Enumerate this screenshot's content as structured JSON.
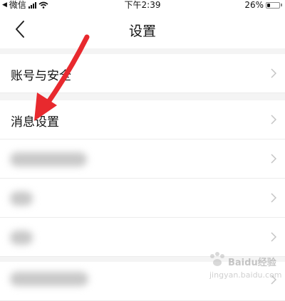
{
  "status_bar": {
    "carrier": "微信",
    "time": "下午2:39",
    "battery_percent": "26%",
    "battery_level": 0.26
  },
  "nav": {
    "title": "设置",
    "back_icon": "chevron-left-icon"
  },
  "sections": [
    {
      "items": [
        {
          "label": "账号与安全"
        }
      ]
    },
    {
      "items": [
        {
          "label": "消息设置"
        },
        {
          "label": ""
        },
        {
          "label": ""
        },
        {
          "label": ""
        }
      ]
    },
    {
      "items": [
        {
          "label": ""
        }
      ]
    }
  ],
  "annotation": {
    "color": "#e8292e",
    "icon": "red-arrow-icon"
  },
  "watermark": {
    "text": "Baidu经验",
    "url": "jingyan.baidu.com"
  }
}
